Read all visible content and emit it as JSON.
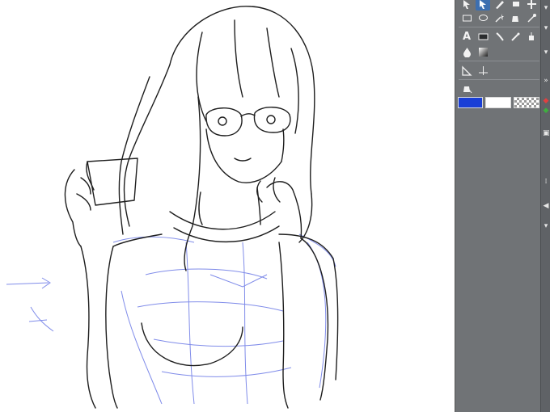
{
  "toolbar": {
    "text_tool_glyph": "A",
    "tools": [
      "move-tool",
      "select-tool",
      "pen-tool",
      "eraser-tool",
      "hand-tool",
      "rect-select-tool",
      "lasso-tool",
      "magic-wand-tool",
      "bucket-tool",
      "eyedropper-tool",
      "text-tool",
      "frame-tool",
      "brush-tool",
      "airbrush-tool",
      "fill-tool",
      "blur-tool",
      "gradient-tool",
      "ruler-tool",
      "figure-tool",
      "subtool-fill-tool"
    ]
  },
  "colors": {
    "main_color": "#1a3fd6",
    "sub_color": "#ffffff",
    "transparent": "checkerboard",
    "panel_bg": "#707376",
    "sketch_line": "#1e1e1e",
    "construction_line": "#6a78e6"
  },
  "right_strip": {
    "marks": [
      "▾",
      "▾",
      "▾",
      "»",
      "◆",
      "◆",
      "▣",
      "⁞",
      "◀",
      "▾"
    ]
  }
}
